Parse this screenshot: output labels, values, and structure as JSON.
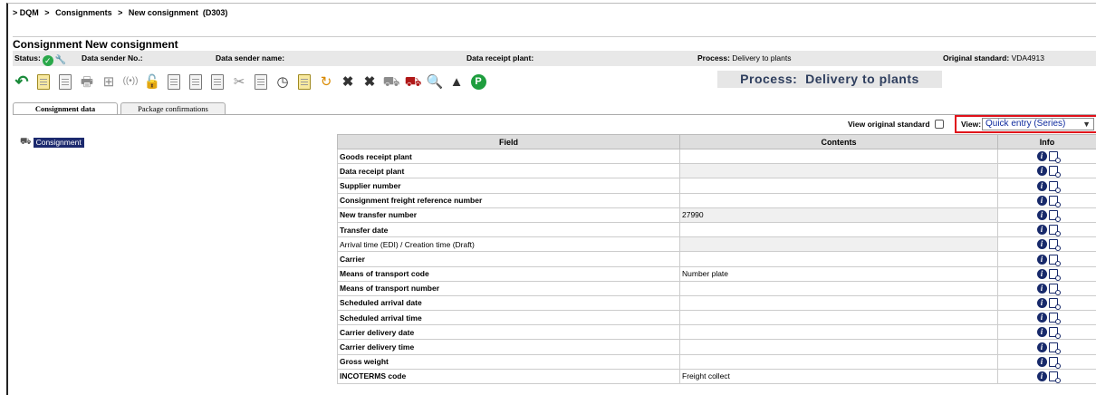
{
  "breadcrumb": {
    "prefix": ">",
    "items": [
      "DQM",
      "Consignments",
      "New consignment  (D303)"
    ]
  },
  "page_title": "Consignment New consignment",
  "status_bar": {
    "status_label": "Status:",
    "data_sender_no_label": "Data sender No.:",
    "data_sender_name_label": "Data sender name:",
    "data_receipt_plant_label": "Data receipt plant:",
    "process_label": "Process:",
    "process_value": "Delivery to plants",
    "original_standard_label": "Original standard:",
    "original_standard_value": "VDA4913"
  },
  "toolbar_icons": [
    "back-arrow-icon",
    "new-document-icon",
    "copy-document-icon",
    "print-icon",
    "grid-icon",
    "radio-signal-icon",
    "unlock-icon",
    "document-list-icon",
    "document-icon",
    "document-copy-icon",
    "cut-icon",
    "paste-icon",
    "clock-icon",
    "export-icon",
    "refresh-icon",
    "delete-icon",
    "delete-all-icon",
    "transport-delete-icon",
    "truck-icon",
    "preview-icon",
    "weight-icon",
    "parking-icon"
  ],
  "process_banner": "Process:  Delivery to plants",
  "tabs": [
    {
      "label": "Consignment data",
      "active": true
    },
    {
      "label": "Package confirmations",
      "active": false
    }
  ],
  "tree": {
    "item_label": "Consignment"
  },
  "view_original_standard_label": "View original standard",
  "view": {
    "label": "View:",
    "selected": "Quick entry (Series)"
  },
  "table": {
    "headers": {
      "field": "Field",
      "contents": "Contents",
      "info": "Info"
    },
    "rows": [
      {
        "field": "Goods receipt plant",
        "contents": "",
        "bold": true,
        "shaded": false
      },
      {
        "field": "Data receipt plant",
        "contents": "",
        "bold": true,
        "shaded": true
      },
      {
        "field": "Supplier number",
        "contents": "",
        "bold": true,
        "shaded": false
      },
      {
        "field": "Consignment freight reference number",
        "contents": "",
        "bold": true,
        "shaded": false
      },
      {
        "field": "New transfer number",
        "contents": "27990",
        "bold": true,
        "shaded": true
      },
      {
        "field": "Transfer date",
        "contents": "",
        "bold": true,
        "shaded": false
      },
      {
        "field": "Arrival time (EDI) / Creation time (Draft)",
        "contents": "",
        "bold": false,
        "shaded": true
      },
      {
        "field": "Carrier",
        "contents": "",
        "bold": true,
        "shaded": false
      },
      {
        "field": "Means of transport code",
        "contents": "Number plate",
        "bold": true,
        "shaded": false
      },
      {
        "field": "Means of transport number",
        "contents": "",
        "bold": true,
        "shaded": false
      },
      {
        "field": "Scheduled arrival date",
        "contents": "",
        "bold": true,
        "shaded": false
      },
      {
        "field": "Scheduled arrival time",
        "contents": "",
        "bold": true,
        "shaded": false
      },
      {
        "field": "Carrier delivery date",
        "contents": "",
        "bold": true,
        "shaded": false
      },
      {
        "field": "Carrier delivery time",
        "contents": "",
        "bold": true,
        "shaded": false
      },
      {
        "field": "Gross weight",
        "contents": "",
        "bold": true,
        "shaded": false
      },
      {
        "field": "INCOTERMS code",
        "contents": "Freight collect",
        "bold": true,
        "shaded": false
      }
    ]
  },
  "colors": {
    "accent_navy": "#1c2a6e",
    "highlight_red": "#e0101a",
    "status_green": "#2aa84a"
  }
}
